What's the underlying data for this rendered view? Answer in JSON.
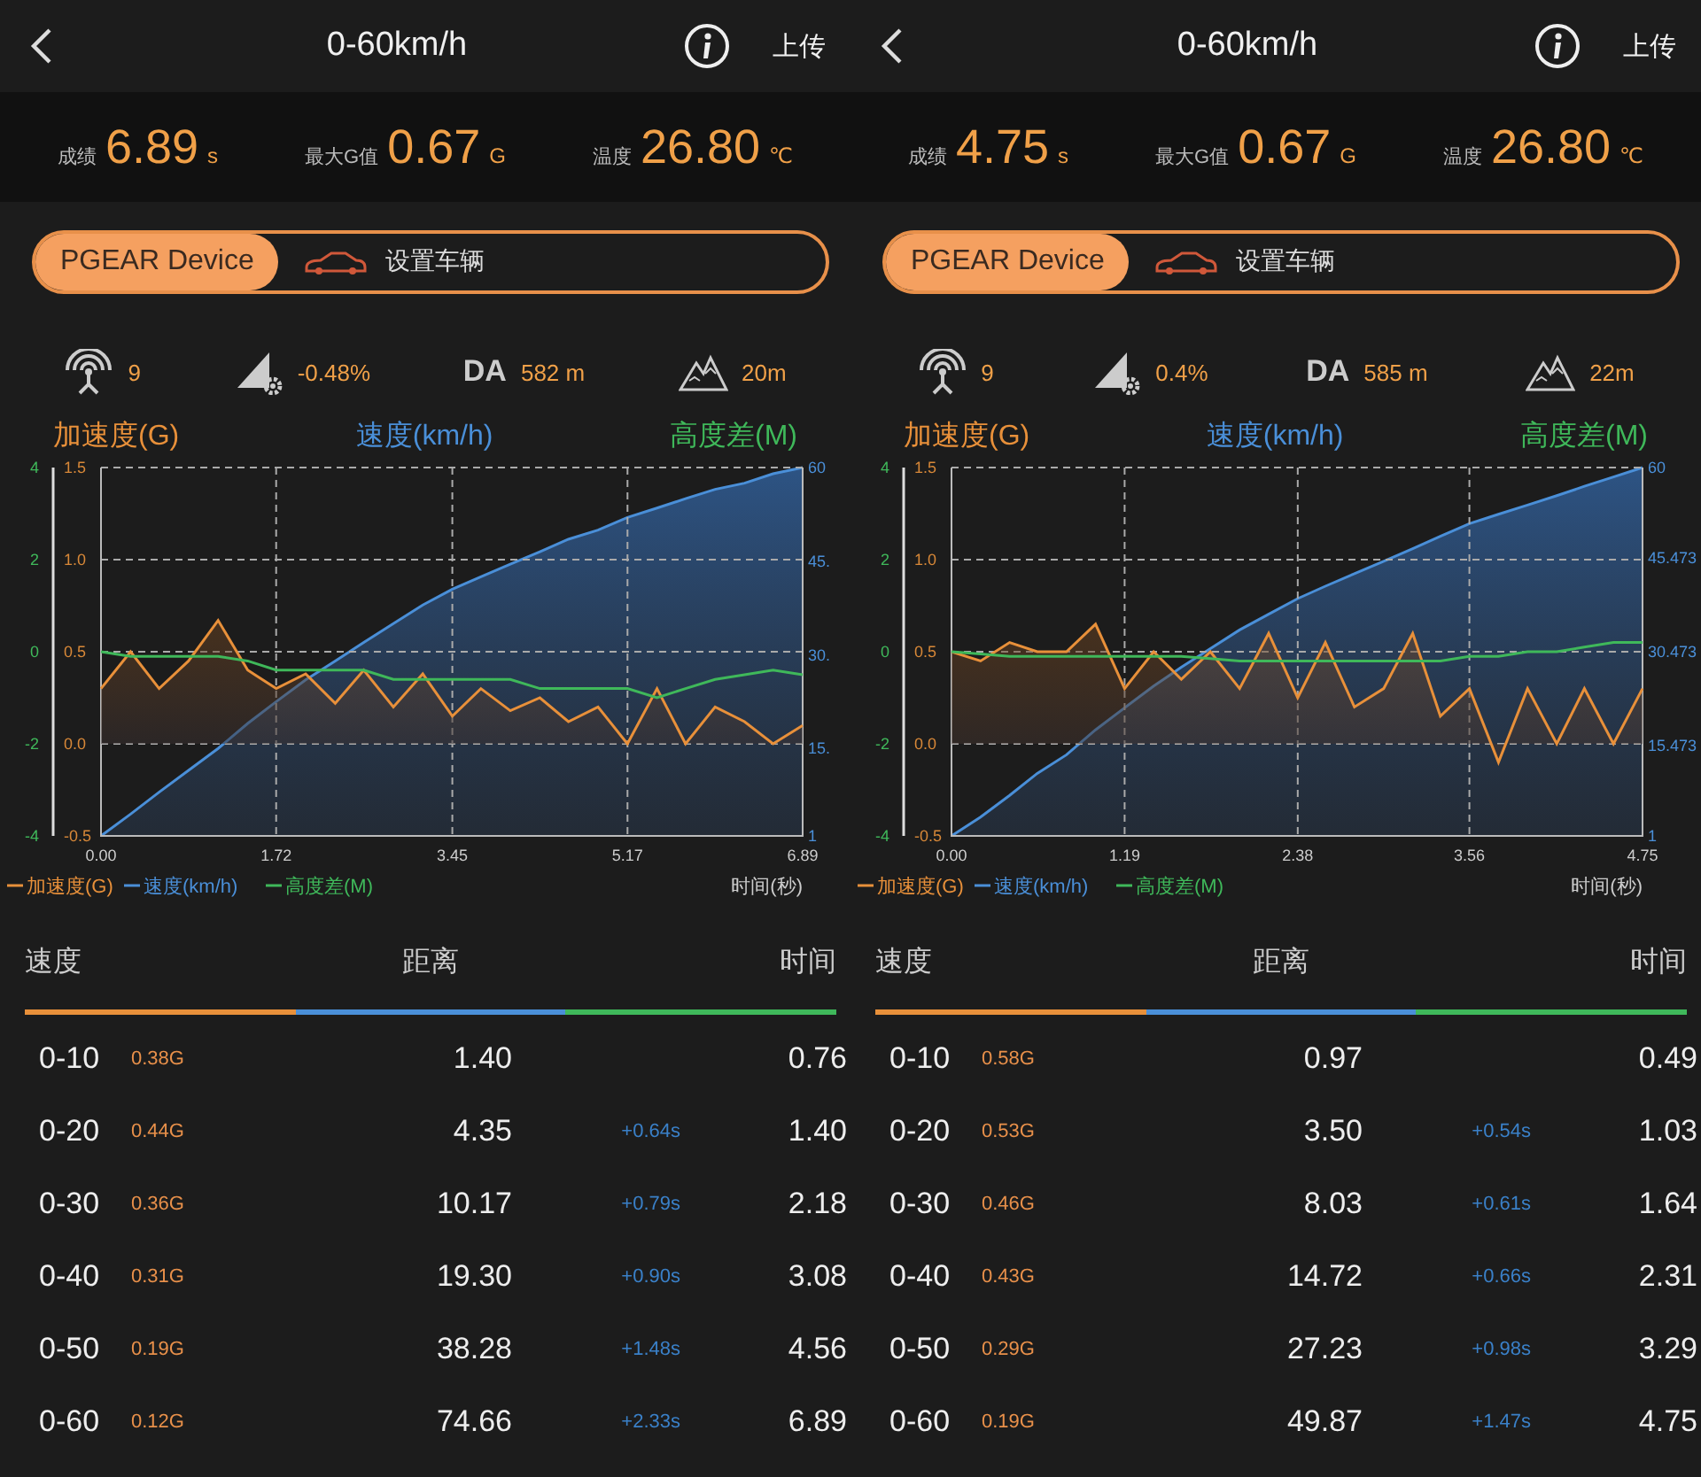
{
  "panels": [
    {
      "header": {
        "title": "0-60km/h",
        "action": "上传"
      },
      "stats": [
        {
          "label": "成绩",
          "value": "6.89",
          "unit": "s"
        },
        {
          "label": "最大G值",
          "value": "0.67",
          "unit": "G"
        },
        {
          "label": "温度",
          "value": "26.80",
          "unit": "℃"
        }
      ],
      "toggle": [
        {
          "label": "PGEAR Device",
          "selected": true
        },
        {
          "label": "设置车辆",
          "selected": false
        }
      ],
      "indicators": [
        {
          "kind": "satellites",
          "value": "9"
        },
        {
          "kind": "slope",
          "value": "-0.48%"
        },
        {
          "kind": "density_altitude",
          "label": "DA",
          "value": "582 m"
        },
        {
          "kind": "elevation",
          "value": "20m"
        }
      ],
      "charts": [
        {
          "chart_data": {
            "type": "area",
            "title": "加速度(G)",
            "xlabel": "时间(秒)",
            "grid": true,
            "legend": "bottom",
            "x": [
              0,
              0.29,
              0.57,
              0.86,
              1.15,
              1.44,
              1.72,
              2.01,
              2.3,
              2.58,
              2.87,
              3.16,
              3.45,
              3.73,
              4.02,
              4.31,
              4.59,
              4.88,
              5.17,
              5.46,
              5.74,
              6.03,
              6.32,
              6.6,
              6.89
            ],
            "xlim": [
              0,
              6.89
            ],
            "ylim": [
              -0.5,
              1.5
            ],
            "xticks": [
              {
                "value": 0,
                "label": "0.00"
              },
              {
                "value": 1.72,
                "label": "1.72"
              },
              {
                "value": 3.45,
                "label": "3.45"
              },
              {
                "value": 5.17,
                "label": "5.17"
              },
              {
                "value": 6.89,
                "label": "6.89"
              }
            ],
            "yticks": [
              {
                "value": 1.5,
                "label": "1.5"
              },
              {
                "value": 1,
                "label": "1.0"
              },
              {
                "value": 0.5,
                "label": "0.5"
              },
              {
                "value": 0,
                "label": "0.0"
              },
              {
                "value": -0.5,
                "label": "-0.5"
              }
            ],
            "series": [
              {
                "name": "加速度(G)",
                "color": "#e8903a",
                "values": [
                  0.3,
                  0.5,
                  0.3,
                  0.45,
                  0.67,
                  0.4,
                  0.3,
                  0.38,
                  0.22,
                  0.4,
                  0.2,
                  0.38,
                  0.15,
                  0.3,
                  0.18,
                  0.25,
                  0.12,
                  0.2,
                  0.0,
                  0.3,
                  0.0,
                  0.2,
                  0.12,
                  0.0,
                  0.1
                ]
              }
            ]
          }
        },
        {
          "chart_data": {
            "type": "area",
            "title": "速度(km/h)",
            "legend": "bottom",
            "x": [
              0,
              0.29,
              0.57,
              0.86,
              1.15,
              1.44,
              1.72,
              2.01,
              2.3,
              2.58,
              2.87,
              3.16,
              3.45,
              3.73,
              4.02,
              4.31,
              4.59,
              4.88,
              5.17,
              5.46,
              5.74,
              6.03,
              6.32,
              6.6,
              6.89
            ],
            "xlim": [
              0,
              6.89
            ],
            "ylim": [
              1,
              60
            ],
            "yticks": [
              {
                "value": 60,
                "label": "60"
              },
              {
                "value": 45,
                "label": "45."
              },
              {
                "value": 30,
                "label": "30."
              },
              {
                "value": 15,
                "label": "15."
              },
              {
                "value": 1,
                "label": "1"
              }
            ],
            "series": [
              {
                "name": "速度(km/h)",
                "color": "#4a8fd8",
                "values": [
                  1,
                  4.5,
                  8,
                  11.5,
                  15,
                  19,
                  22.5,
                  26,
                  29,
                  32,
                  35,
                  38,
                  40.5,
                  42.5,
                  44.5,
                  46.5,
                  48.5,
                  50,
                  52,
                  53.5,
                  55,
                  56.5,
                  57.5,
                  59,
                  60
                ]
              }
            ]
          }
        },
        {
          "chart_data": {
            "type": "line",
            "title": "高度差(M)",
            "legend": "bottom",
            "x": [
              0,
              0.29,
              0.57,
              0.86,
              1.15,
              1.44,
              1.72,
              2.01,
              2.3,
              2.58,
              2.87,
              3.16,
              3.45,
              3.73,
              4.02,
              4.31,
              4.59,
              4.88,
              5.17,
              5.46,
              5.74,
              6.03,
              6.32,
              6.6,
              6.89
            ],
            "xlim": [
              0,
              6.89
            ],
            "ylim": [
              -4,
              4
            ],
            "yticks": [
              4,
              2,
              0,
              -2,
              -4
            ],
            "series": [
              {
                "name": "高度差(M)",
                "color": "#3fb85a",
                "values": [
                  0,
                  -0.1,
                  -0.1,
                  -0.1,
                  -0.1,
                  -0.2,
                  -0.4,
                  -0.4,
                  -0.4,
                  -0.4,
                  -0.6,
                  -0.6,
                  -0.6,
                  -0.6,
                  -0.6,
                  -0.8,
                  -0.8,
                  -0.8,
                  -0.8,
                  -1.0,
                  -0.8,
                  -0.6,
                  -0.5,
                  -0.4,
                  -0.5
                ]
              }
            ]
          }
        }
      ],
      "table": {
        "columns": [
          "速度",
          "距离",
          "时间"
        ],
        "rows": [
          {
            "speed": "0-10",
            "g": "0.38G",
            "distance": "1.40",
            "time": "0.76"
          },
          {
            "speed": "0-20",
            "g": "0.44G",
            "distance": "4.35",
            "delta": "+0.64s",
            "time": "1.40"
          },
          {
            "speed": "0-30",
            "g": "0.36G",
            "distance": "10.17",
            "delta": "+0.79s",
            "time": "2.18"
          },
          {
            "speed": "0-40",
            "g": "0.31G",
            "distance": "19.30",
            "delta": "+0.90s",
            "time": "3.08"
          },
          {
            "speed": "0-50",
            "g": "0.19G",
            "distance": "38.28",
            "delta": "+1.48s",
            "time": "4.56"
          },
          {
            "speed": "0-60",
            "g": "0.12G",
            "distance": "74.66",
            "delta": "+2.33s",
            "time": "6.89"
          }
        ]
      }
    },
    {
      "header": {
        "title": "0-60km/h",
        "action": "上传"
      },
      "stats": [
        {
          "label": "成绩",
          "value": "4.75",
          "unit": "s"
        },
        {
          "label": "最大G值",
          "value": "0.67",
          "unit": "G"
        },
        {
          "label": "温度",
          "value": "26.80",
          "unit": "℃"
        }
      ],
      "toggle": [
        {
          "label": "PGEAR Device",
          "selected": true
        },
        {
          "label": "设置车辆",
          "selected": false
        }
      ],
      "indicators": [
        {
          "kind": "satellites",
          "value": "9"
        },
        {
          "kind": "slope",
          "value": "0.4%"
        },
        {
          "kind": "density_altitude",
          "label": "DA",
          "value": "585 m"
        },
        {
          "kind": "elevation",
          "value": "22m"
        }
      ],
      "charts": [
        {
          "chart_data": {
            "type": "area",
            "title": "加速度(G)",
            "xlabel": "时间(秒)",
            "grid": true,
            "legend": "bottom",
            "x": [
              0,
              0.2,
              0.4,
              0.59,
              0.79,
              0.99,
              1.19,
              1.39,
              1.58,
              1.78,
              1.98,
              2.18,
              2.38,
              2.57,
              2.77,
              2.97,
              3.17,
              3.36,
              3.56,
              3.76,
              3.96,
              4.16,
              4.35,
              4.55,
              4.75
            ],
            "xlim": [
              0,
              4.75
            ],
            "ylim": [
              -0.5,
              1.5
            ],
            "xticks": [
              {
                "value": 0,
                "label": "0.00"
              },
              {
                "value": 1.19,
                "label": "1.19"
              },
              {
                "value": 2.38,
                "label": "2.38"
              },
              {
                "value": 3.56,
                "label": "3.56"
              },
              {
                "value": 4.75,
                "label": "4.75"
              }
            ],
            "yticks": [
              {
                "value": 1.5,
                "label": "1.5"
              },
              {
                "value": 1,
                "label": "1.0"
              },
              {
                "value": 0.5,
                "label": "0.5"
              },
              {
                "value": 0,
                "label": "0.0"
              },
              {
                "value": -0.5,
                "label": "-0.5"
              }
            ],
            "series": [
              {
                "name": "加速度(G)",
                "color": "#e8903a",
                "values": [
                  0.5,
                  0.45,
                  0.55,
                  0.5,
                  0.5,
                  0.65,
                  0.3,
                  0.5,
                  0.35,
                  0.5,
                  0.3,
                  0.6,
                  0.25,
                  0.55,
                  0.2,
                  0.3,
                  0.6,
                  0.15,
                  0.3,
                  -0.1,
                  0.3,
                  0.0,
                  0.3,
                  0.0,
                  0.3
                ]
              }
            ]
          }
        },
        {
          "chart_data": {
            "type": "area",
            "title": "速度(km/h)",
            "legend": "bottom",
            "x": [
              0,
              0.2,
              0.4,
              0.59,
              0.79,
              0.99,
              1.19,
              1.39,
              1.58,
              1.78,
              1.98,
              2.18,
              2.38,
              2.57,
              2.77,
              2.97,
              3.17,
              3.36,
              3.56,
              3.76,
              3.96,
              4.16,
              4.35,
              4.55,
              4.75
            ],
            "xlim": [
              0,
              4.75
            ],
            "ylim": [
              1,
              60
            ],
            "yticks": [
              {
                "value": 60,
                "label": "60"
              },
              {
                "value": 45.473,
                "label": "45.473"
              },
              {
                "value": 30.473,
                "label": "30.473"
              },
              {
                "value": 15.473,
                "label": "15.473"
              },
              {
                "value": 1,
                "label": "1"
              }
            ],
            "series": [
              {
                "name": "速度(km/h)",
                "color": "#4a8fd8",
                "values": [
                  1,
                  4,
                  7.5,
                  11,
                  14,
                  18,
                  21.5,
                  25,
                  28,
                  31,
                  34,
                  36.5,
                  39,
                  41,
                  43,
                  45,
                  47,
                  49,
                  51,
                  52.5,
                  54,
                  55.5,
                  57,
                  58.5,
                  60
                ]
              }
            ]
          }
        },
        {
          "chart_data": {
            "type": "line",
            "title": "高度差(M)",
            "legend": "bottom",
            "x": [
              0,
              0.2,
              0.4,
              0.59,
              0.79,
              0.99,
              1.19,
              1.39,
              1.58,
              1.78,
              1.98,
              2.18,
              2.38,
              2.57,
              2.77,
              2.97,
              3.17,
              3.36,
              3.56,
              3.76,
              3.96,
              4.16,
              4.35,
              4.55,
              4.75
            ],
            "xlim": [
              0,
              4.75
            ],
            "ylim": [
              -4,
              4
            ],
            "yticks": [
              4,
              2,
              0,
              -2,
              -4
            ],
            "series": [
              {
                "name": "高度差(M)",
                "color": "#3fb85a",
                "values": [
                  0,
                  -0.05,
                  -0.1,
                  -0.1,
                  -0.1,
                  -0.1,
                  -0.1,
                  -0.1,
                  -0.1,
                  -0.15,
                  -0.2,
                  -0.2,
                  -0.2,
                  -0.2,
                  -0.2,
                  -0.2,
                  -0.2,
                  -0.2,
                  -0.1,
                  -0.1,
                  0,
                  0,
                  0.1,
                  0.2,
                  0.2
                ]
              }
            ]
          }
        }
      ],
      "table": {
        "columns": [
          "速度",
          "距离",
          "时间"
        ],
        "rows": [
          {
            "speed": "0-10",
            "g": "0.58G",
            "distance": "0.97",
            "time": "0.49"
          },
          {
            "speed": "0-20",
            "g": "0.53G",
            "distance": "3.50",
            "delta": "+0.54s",
            "time": "1.03"
          },
          {
            "speed": "0-30",
            "g": "0.46G",
            "distance": "8.03",
            "delta": "+0.61s",
            "time": "1.64"
          },
          {
            "speed": "0-40",
            "g": "0.43G",
            "distance": "14.72",
            "delta": "+0.66s",
            "time": "2.31"
          },
          {
            "speed": "0-50",
            "g": "0.29G",
            "distance": "27.23",
            "delta": "+0.98s",
            "time": "3.29"
          },
          {
            "speed": "0-60",
            "g": "0.19G",
            "distance": "49.87",
            "delta": "+1.47s",
            "time": "4.75"
          }
        ]
      }
    }
  ]
}
